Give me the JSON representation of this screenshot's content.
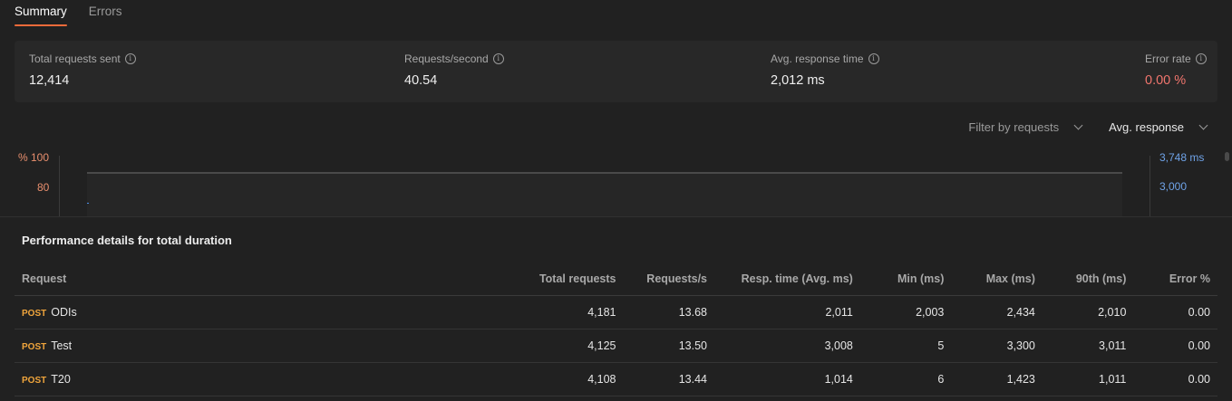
{
  "tabs": [
    {
      "label": "Summary"
    },
    {
      "label": "Errors"
    }
  ],
  "metrics": [
    {
      "label": "Total requests sent",
      "value": "12,414"
    },
    {
      "label": "Requests/second",
      "value": "40.54"
    },
    {
      "label": "Avg. response time",
      "value": "2,012 ms"
    },
    {
      "label": "Error rate",
      "value": "0.00 %"
    }
  ],
  "filters": {
    "requests": "Filter by requests",
    "metric": "Avg. response"
  },
  "chart": {
    "left_unit": "%",
    "left_ticks": [
      "100",
      "80"
    ],
    "right_ticks": [
      "3,748 ms",
      "3,000"
    ]
  },
  "perf": {
    "title": "Performance details for total duration",
    "columns": [
      "Request",
      "Total requests",
      "Requests/s",
      "Resp. time (Avg. ms)",
      "Min (ms)",
      "Max (ms)",
      "90th (ms)",
      "Error %"
    ],
    "rows": [
      {
        "method": "POST",
        "name": "ODIs",
        "total": "4,181",
        "rps": "13.68",
        "avg": "2,011",
        "min": "2,003",
        "max": "2,434",
        "p90": "2,010",
        "err": "0.00"
      },
      {
        "method": "POST",
        "name": "Test",
        "total": "4,125",
        "rps": "13.50",
        "avg": "3,008",
        "min": "5",
        "max": "3,300",
        "p90": "3,011",
        "err": "0.00"
      },
      {
        "method": "POST",
        "name": "T20",
        "total": "4,108",
        "rps": "13.44",
        "avg": "1,014",
        "min": "6",
        "max": "1,423",
        "p90": "1,011",
        "err": "0.00"
      }
    ]
  },
  "colors": {
    "accent": "#f26b3a",
    "error": "#f0756d",
    "method": "#f0a53c",
    "right_axis": "#6fa3e8"
  }
}
